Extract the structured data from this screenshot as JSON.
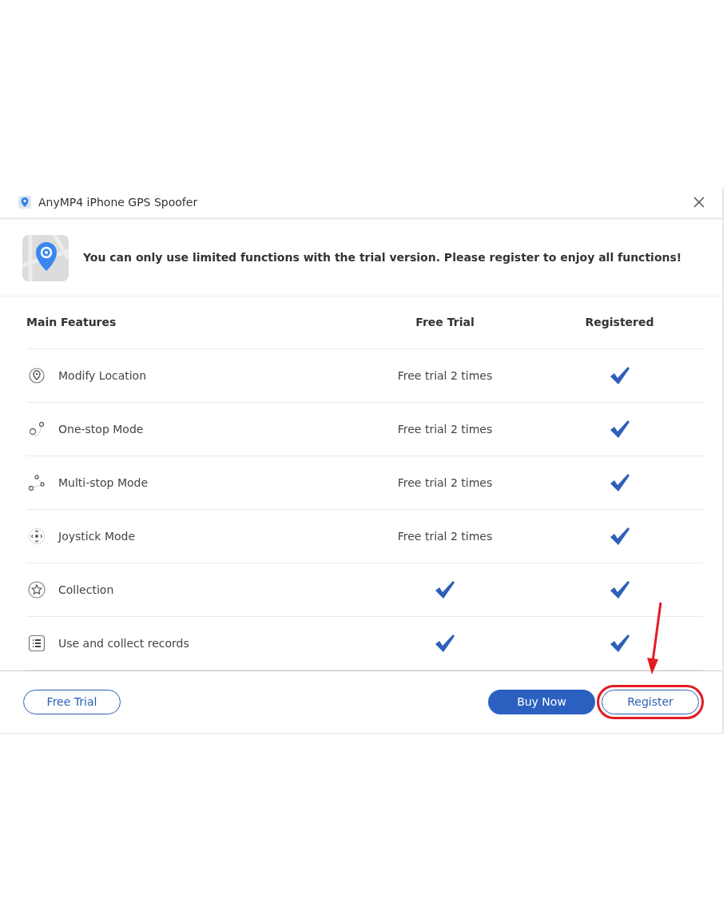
{
  "window": {
    "title": "AnyMP4 iPhone GPS Spoofer"
  },
  "banner": {
    "message": "You can only use limited functions with the trial version. Please register to enjoy all functions!"
  },
  "table": {
    "columns": [
      "Main Features",
      "Free Trial",
      "Registered"
    ],
    "rows": [
      {
        "feature": "Modify Location",
        "free_trial": {
          "kind": "text",
          "text": "Free trial 2 times"
        },
        "registered": {
          "kind": "check"
        }
      },
      {
        "feature": "One-stop Mode",
        "free_trial": {
          "kind": "text",
          "text": "Free trial 2 times"
        },
        "registered": {
          "kind": "check"
        }
      },
      {
        "feature": "Multi-stop Mode",
        "free_trial": {
          "kind": "text",
          "text": "Free trial 2 times"
        },
        "registered": {
          "kind": "check"
        }
      },
      {
        "feature": "Joystick Mode",
        "free_trial": {
          "kind": "text",
          "text": "Free trial 2 times"
        },
        "registered": {
          "kind": "check"
        }
      },
      {
        "feature": "Collection",
        "free_trial": {
          "kind": "check"
        },
        "registered": {
          "kind": "check"
        }
      },
      {
        "feature": "Use and collect records",
        "free_trial": {
          "kind": "check"
        },
        "registered": {
          "kind": "check"
        }
      }
    ]
  },
  "footer": {
    "buttons": [
      {
        "label": "Free Trial",
        "kind": "outline",
        "highlighted": false
      },
      {
        "label": "Buy Now",
        "kind": "filled",
        "highlighted": false
      },
      {
        "label": "Register",
        "kind": "outline",
        "highlighted": true
      }
    ]
  }
}
